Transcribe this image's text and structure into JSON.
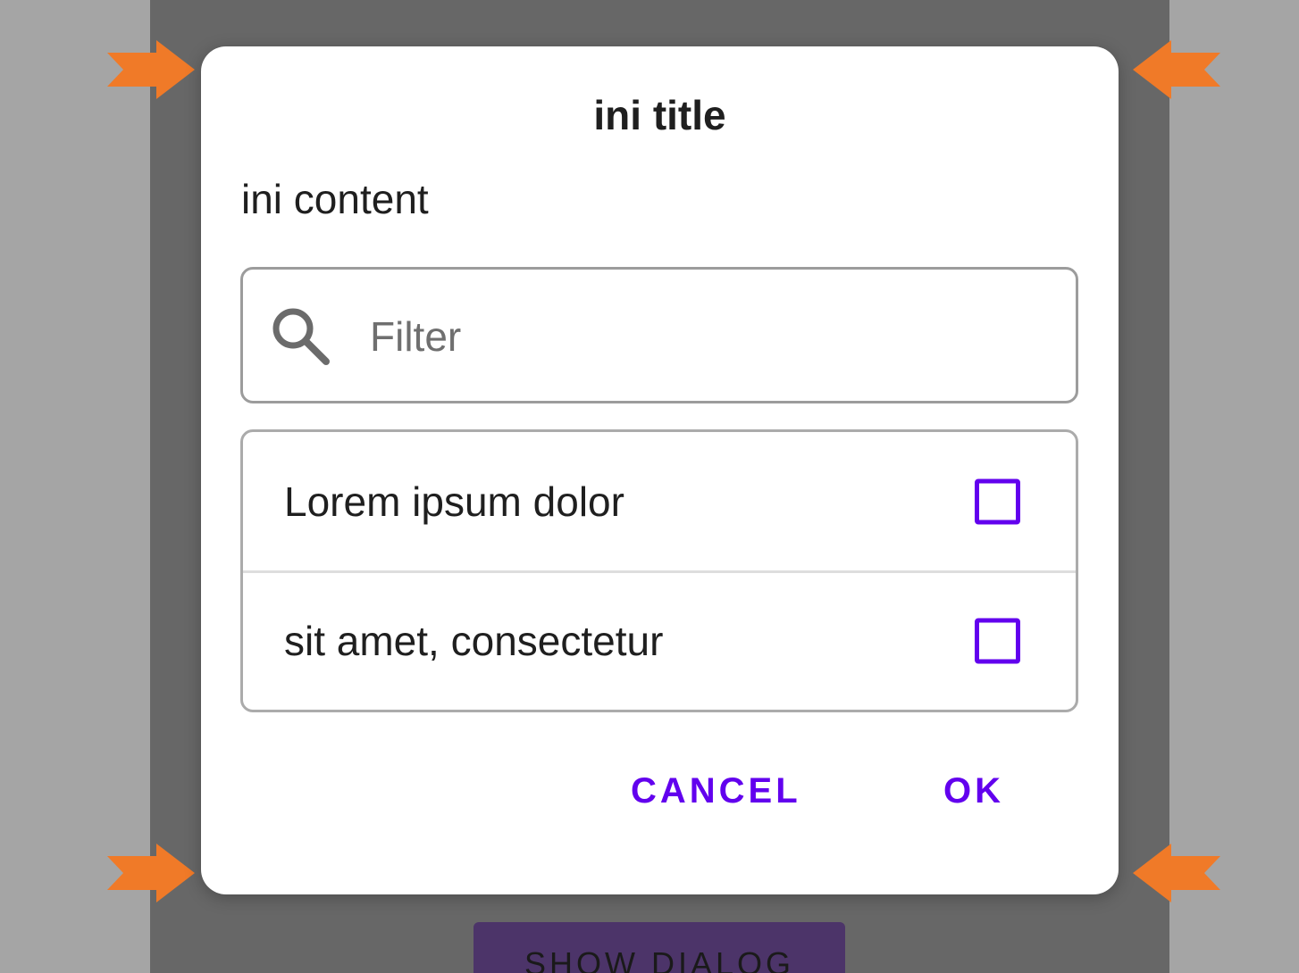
{
  "colors": {
    "accent": "#6200ee",
    "scrim": "#676767",
    "outer_background": "#a5a5a5",
    "annotation_arrow": "#f07a28",
    "show_dialog_button": "#4c3469"
  },
  "dialog": {
    "title": "ini title",
    "content": "ini content",
    "filter": {
      "icon": "search-icon",
      "placeholder": "Filter",
      "value": ""
    },
    "items": [
      {
        "label": "Lorem ipsum dolor",
        "checked": false
      },
      {
        "label": "sit amet, consectetur",
        "checked": false
      }
    ],
    "actions": {
      "cancel_label": "CANCEL",
      "ok_label": "OK"
    }
  },
  "background": {
    "show_dialog_label": "SHOW DIALOG"
  },
  "annotations": {
    "arrow_icon": "orange-arrow-icon",
    "arrow_count": 4
  }
}
